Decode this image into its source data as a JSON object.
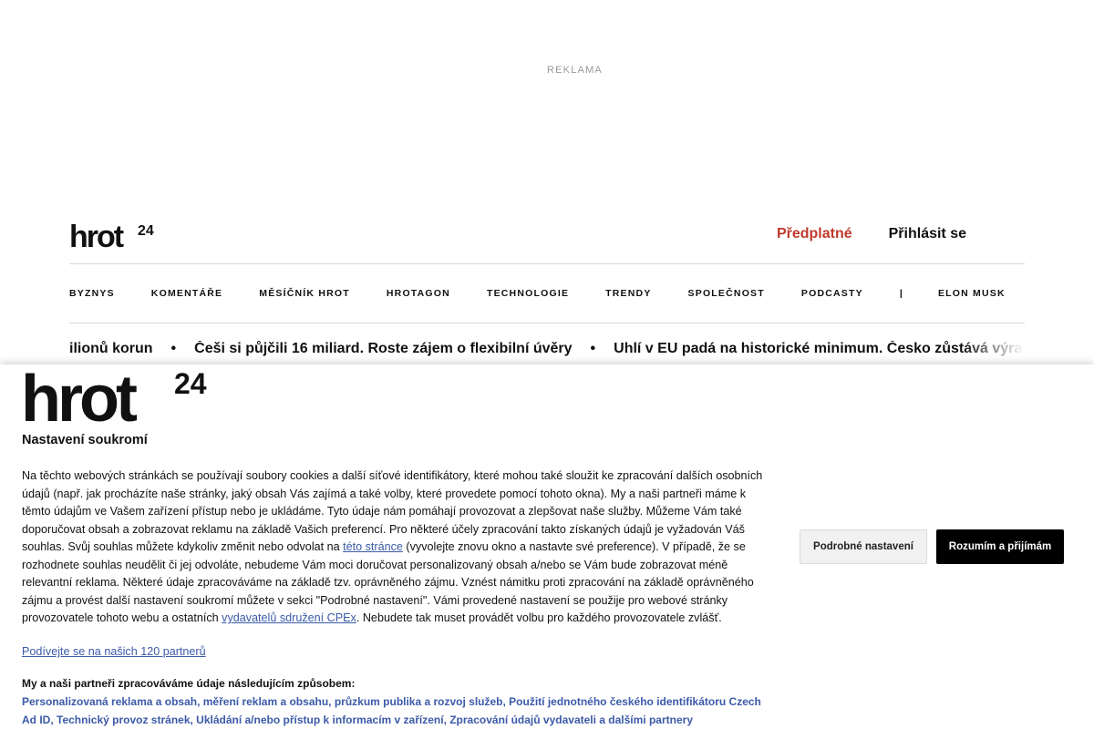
{
  "ad": {
    "label": "REKLAMA"
  },
  "header": {
    "logo_text": "hrot",
    "logo_sup": "24",
    "subscribe_label": "Předplatné",
    "login_label": "Přihlásit se"
  },
  "nav": {
    "items": [
      "BYZNYS",
      "KOMENTÁŘE",
      "MĚSÍČNÍK HROT",
      "HROTAGON",
      "TECHNOLOGIE",
      "TRENDY",
      "SPOLEČNOST",
      "PODCASTY",
      "|",
      "ELON MUSK"
    ]
  },
  "ticker": {
    "items": [
      "ilionů korun",
      "Češi si půjčili 16 miliard. Roste zájem o flexibilní úvěry",
      "Uhlí v EU padá na historické minimum. Česko zůstává výra"
    ],
    "separator": "•"
  },
  "consent": {
    "logo_text": "hrot",
    "logo_sup": "24",
    "title": "Nastavení soukromí",
    "text_1": "Na těchto webových stránkách se používají soubory cookies a další síťové identifikátory, které mohou také sloužit ke zpracování dalších osobních údajů (např. jak procházíte naše stránky, jaký obsah Vás zajímá a také volby, které provedete pomocí tohoto okna). My a naši partneři máme k těmto údajům ve Vašem zařízení přístup nebo je ukládáme. Tyto údaje nám pomáhají provozovat a zlepšovat naše služby. Můžeme Vám také doporučovat obsah a zobrazovat reklamu na základě Vašich preferencí. Pro některé účely zpracování takto získaných údajů je vyžadován Váš souhlas. Svůj souhlas můžete kdykoliv změnit nebo odvolat na ",
    "link_1": "této stránce",
    "text_2": " (vyvolejte znovu okno a nastavte své preference). V případě, že se rozhodnete souhlas neudělit či jej odvoláte, nebudeme Vám moci doručovat personalizovaný obsah a/nebo se Vám bude zobrazovat méně relevantní reklama. Některé údaje zpracováváme na základě tzv. oprávněného zájmu. Vznést námitku proti zpracování na základě oprávněného zájmu a provést další nastavení soukromí můžete v sekci \"Podrobné nastavení\". Vámi provedené nastavení se použije pro webové stránky provozovatele tohoto webu a ostatních ",
    "link_2": "vydavatelů sdružení CPEx",
    "text_3": ". Nebudete tak muset provádět volbu pro každého provozovatele zvlášť.",
    "partners_link": "Podívejte se na našich 120 partnerů",
    "purposes_title": "My a naši partneři zpracováváme údaje následujícím způsobem:",
    "purposes_text": "Personalizovaná reklama a obsah, měření reklam a obsahu, průzkum publika a rozvoj služeb, Použití jednotného českého identifikátoru Czech Ad ID, Technický provoz stránek, Ukládání a/nebo přístup k informacím v zařízení, Zpracování údajů vydavateli a dalšími partnery",
    "btn_detail": "Podrobné nastavení",
    "btn_accept": "Rozumím a přijímám"
  },
  "colors": {
    "accent": "#c0392b",
    "link": "#3b5aa8",
    "accept_bg": "#000000"
  }
}
